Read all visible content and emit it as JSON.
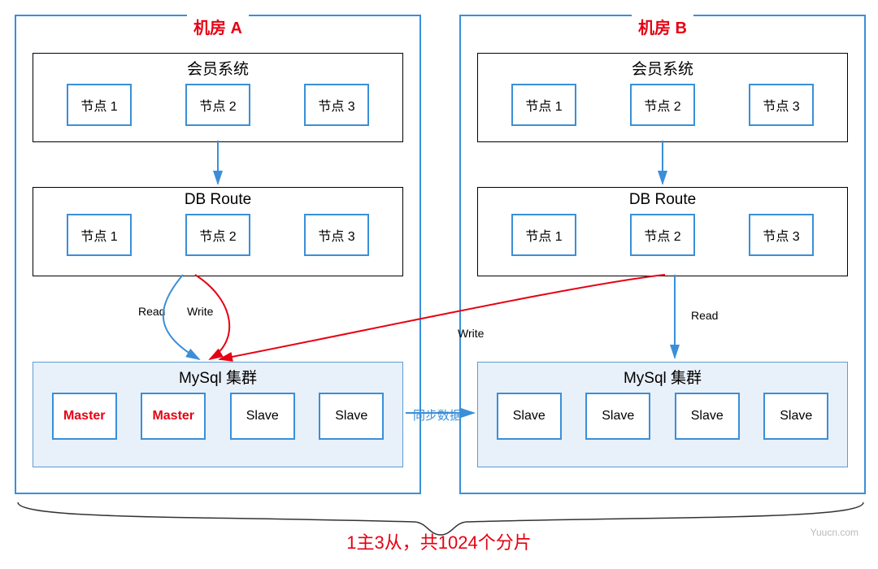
{
  "dc_a": {
    "title": "机房 A",
    "member_system": {
      "title": "会员系统",
      "nodes": [
        "节点 1",
        "节点 2",
        "节点 3"
      ]
    },
    "db_route": {
      "title": "DB Route",
      "nodes": [
        "节点 1",
        "节点 2",
        "节点 3"
      ]
    },
    "mysql": {
      "title": "MySql 集群",
      "nodes": [
        {
          "label": "Master",
          "role": "master"
        },
        {
          "label": "Master",
          "role": "master"
        },
        {
          "label": "Slave",
          "role": "slave"
        },
        {
          "label": "Slave",
          "role": "slave"
        }
      ]
    },
    "labels": {
      "read": "Read",
      "write": "Write"
    }
  },
  "dc_b": {
    "title": "机房 B",
    "member_system": {
      "title": "会员系统",
      "nodes": [
        "节点 1",
        "节点 2",
        "节点 3"
      ]
    },
    "db_route": {
      "title": "DB Route",
      "nodes": [
        "节点 1",
        "节点 2",
        "节点 3"
      ]
    },
    "mysql": {
      "title": "MySql 集群",
      "nodes": [
        {
          "label": "Slave",
          "role": "slave"
        },
        {
          "label": "Slave",
          "role": "slave"
        },
        {
          "label": "Slave",
          "role": "slave"
        },
        {
          "label": "Slave",
          "role": "slave"
        }
      ]
    },
    "labels": {
      "read": "Read",
      "write": "Write"
    }
  },
  "sync_label": "同步数据",
  "summary": "1主3从，共1024个分片",
  "watermark": "Yuucn.com"
}
